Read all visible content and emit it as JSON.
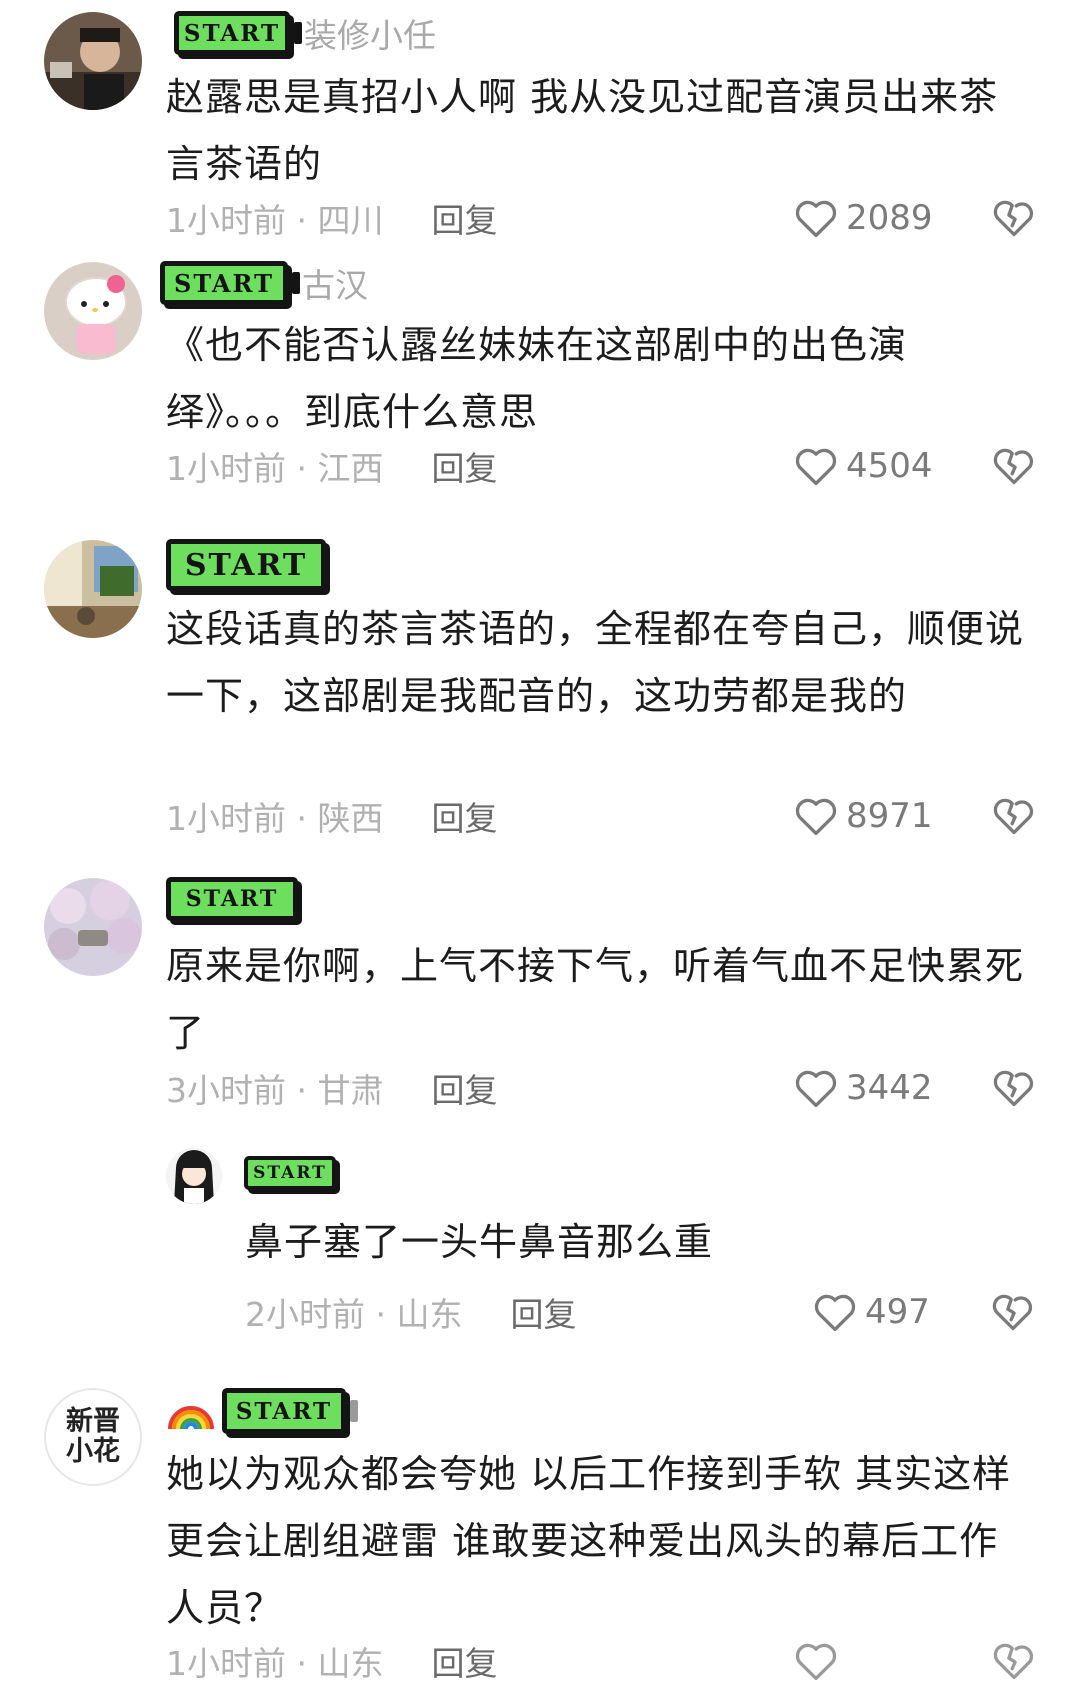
{
  "badge_text": "START",
  "comments": [
    {
      "username": "装修小任",
      "avatar": "photo-person",
      "text": "赵露思是真招小人啊 我从没见过配音演员出来茶言茶语的",
      "time": "1小时前 · 四川",
      "reply": "回复",
      "likes": "2089"
    },
    {
      "username": "古汉",
      "avatar": "hello-kitty",
      "text": "《也不能否认露丝妹妹在这部剧中的出色演绎》。。。到底什么意思",
      "time": "1小时前 · 江西",
      "reply": "回复",
      "likes": "4504"
    },
    {
      "username": "",
      "avatar": "photo-room",
      "text": "这段话真的茶言茶语的，全程都在夸自己，顺便说一下，这部剧是我配音的，这功劳都是我的",
      "time": "1小时前 · 陕西",
      "reply": "回复",
      "likes": "8971"
    },
    {
      "username": "",
      "avatar": "photo-blossom",
      "text": "原来是你啊，上气不接下气，听着气血不足快累死了",
      "time": "3小时前 · 甘肃",
      "reply": "回复",
      "likes": "3442"
    },
    {
      "username": "",
      "avatar": "anime-girl",
      "text": "鼻子塞了一头牛鼻音那么重",
      "time": "2小时前 · 山东",
      "reply": "回复",
      "likes": "497",
      "is_reply": true
    },
    {
      "username": "",
      "avatar_text": "新晋\n小花",
      "text": "她以为观众都会夸她 以后工作接到手软 其实这样更会让剧组避雷 谁敢要这种爱出风头的幕后工作人员？",
      "time": "1小时前 · 山东",
      "reply": "回复",
      "likes": ""
    }
  ],
  "colors": {
    "badge_green": "#6ede5e",
    "badge_border": "#141414",
    "meta_gray": "#b1b1b1"
  }
}
